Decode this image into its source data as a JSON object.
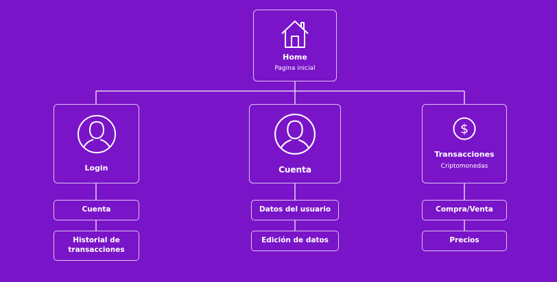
{
  "colors": {
    "background": "#7a14c8",
    "stroke": "#ffffff"
  },
  "root": {
    "title": "Home",
    "subtitle": "Pagina inicial",
    "icon": "home-icon"
  },
  "branches": [
    {
      "title": "Login",
      "subtitle": "",
      "icon": "user-icon",
      "children": [
        "Cuenta",
        "Historial de transacciones"
      ]
    },
    {
      "title": "Cuenta",
      "subtitle": "",
      "icon": "user-icon",
      "children": [
        "Datos del usuario",
        "Edición de datos"
      ]
    },
    {
      "title": "Transacciones",
      "subtitle": "Criptomonedas",
      "icon": "dollar-icon",
      "children": [
        "Compra/Venta",
        "Precios"
      ]
    }
  ]
}
